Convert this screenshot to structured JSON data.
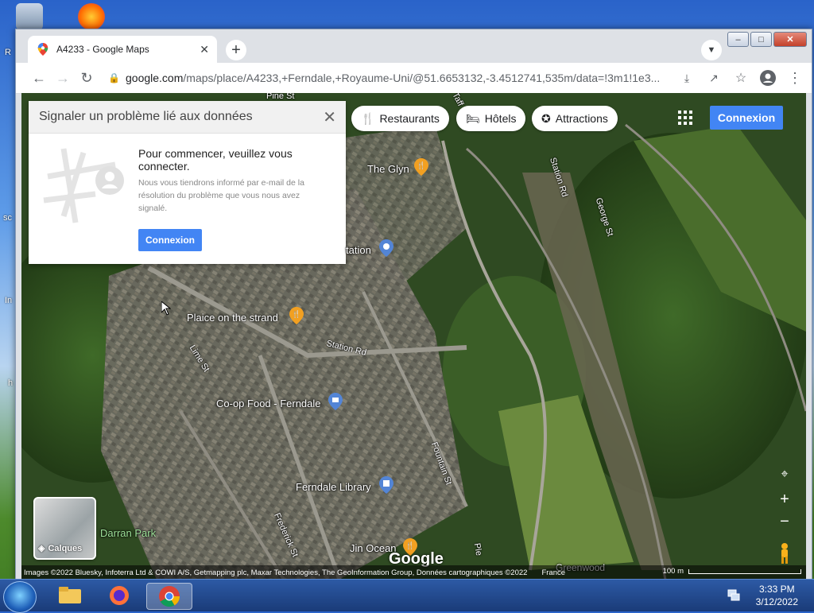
{
  "desktop": {
    "edge_labels": [
      "R",
      "sc",
      "In",
      "h"
    ]
  },
  "browser": {
    "tab": {
      "title": "A4233 - Google Maps",
      "close_glyph": "✕"
    },
    "new_tab_glyph": "+",
    "window_controls": {
      "minimize": "–",
      "maximize": "□",
      "close": "✕"
    },
    "url_host": "google.com",
    "url_path": "/maps/place/A4233,+Ferndale,+Royaume-Uni/@51.6653132,-3.4512741,535m/data=!3m1!1e3..."
  },
  "map": {
    "chips": [
      {
        "label": "Restaurants",
        "icon": "fork-knife-icon"
      },
      {
        "label": "Hôtels",
        "icon": "bed-icon"
      },
      {
        "label": "Attractions",
        "icon": "ferris-wheel-icon"
      }
    ],
    "login_label": "Connexion",
    "report_panel": {
      "title": "Signaler un problème lié aux données",
      "main_text": "Pour commencer, veuillez vous connecter.",
      "sub_text": "Nous vous tiendrons informé par e-mail de la résolution du problème que vous nous avez signalé.",
      "button_label": "Connexion"
    },
    "places": {
      "glyn": "The Glyn",
      "station": "tation",
      "plaice": "Plaice on the strand",
      "coop": "Co-op Food - Ferndale",
      "library": "Ferndale Library",
      "jin": "Jin Ocean",
      "darran": "Darran Park",
      "greenwood": "Greenwood"
    },
    "streets": {
      "pine": "Pine St",
      "taff": "Taff",
      "station_rd_1": "Station Rd",
      "station_rd_2": "Station Rd",
      "george": "George St",
      "lime": "Lime St",
      "fountain": "Fountain St",
      "frederick": "Frederick St",
      "ple": "Ple"
    },
    "layers_label": "Calques",
    "google_logo": "Google",
    "attribution": "Images ©2022 Bluesky, Infoterra Ltd & COWI A/S, Getmapping plc, Maxar Technologies, The GeoInformation Group, Données cartographiques ©2022",
    "country": "France",
    "scale_label": "100 m"
  },
  "taskbar": {
    "time": "3:33 PM",
    "date": "3/12/2022"
  },
  "colors": {
    "accent_blue": "#4285f4",
    "poi_orange": "#f2a021",
    "poi_blue": "#5385d6"
  }
}
